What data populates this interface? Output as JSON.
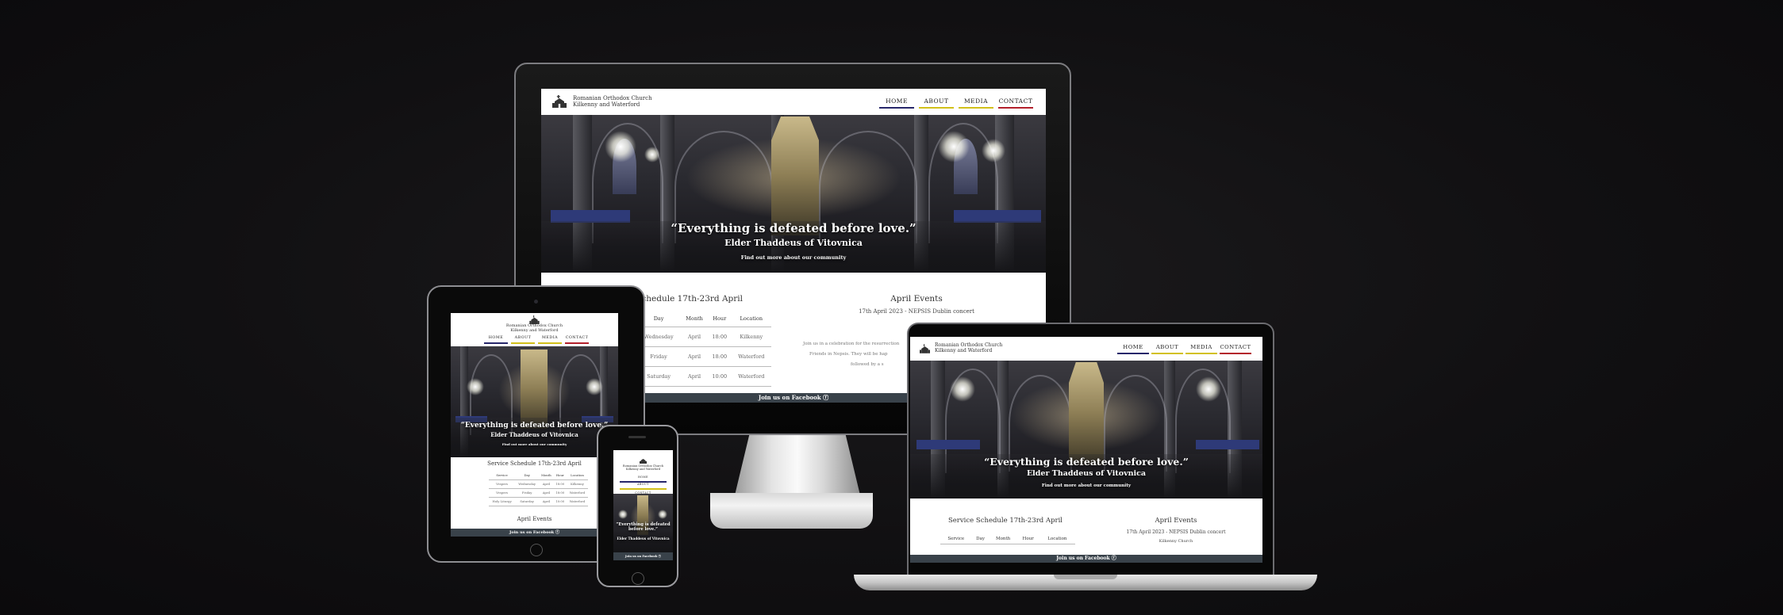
{
  "site": {
    "brand_line1": "Romanian Orthodox Church",
    "brand_line2": "Kilkenny and Waterford",
    "nav": [
      "HOME",
      "ABOUT",
      "MEDIA",
      "CONTACT"
    ],
    "hero_quote": "“Everything is defeated before love.”",
    "hero_author": "Elder Thaddeus of Vitovnica",
    "hero_link": "Find out more about our community",
    "schedule_title": "Service Schedule 17th-23rd April",
    "schedule_title_cropped": "ice Schedule 17th-23rd April",
    "schedule_headers": [
      "Service",
      "Day",
      "Month",
      "Hour",
      "Location"
    ],
    "schedule_rows": [
      [
        "Vespers",
        "Wednesday",
        "April",
        "18:00",
        "Kilkenny"
      ],
      [
        "Vespers",
        "Friday",
        "April",
        "18:00",
        "Waterford"
      ],
      [
        "Holy Liturgy",
        "Saturday",
        "April",
        "10:00",
        "Waterford"
      ]
    ],
    "events_title": "April Events",
    "event_headline": "17th April 2023 - NEPSIS Dublin concert",
    "event_place": "Kilkenny Church",
    "event_body_1": "Join us in a celebration for the resurrection",
    "event_body_2": "Friends in Nepsis. They will be hap",
    "event_body_3": "followed by a s",
    "footer": "Join us on Facebook ⓕ"
  },
  "colors": {
    "nav_home": "#27276a",
    "nav_about": "#d2c01a",
    "nav_media": "#d2c01a",
    "nav_contact": "#b3202b",
    "footer_bg": "#39424a",
    "background": "#111012"
  }
}
